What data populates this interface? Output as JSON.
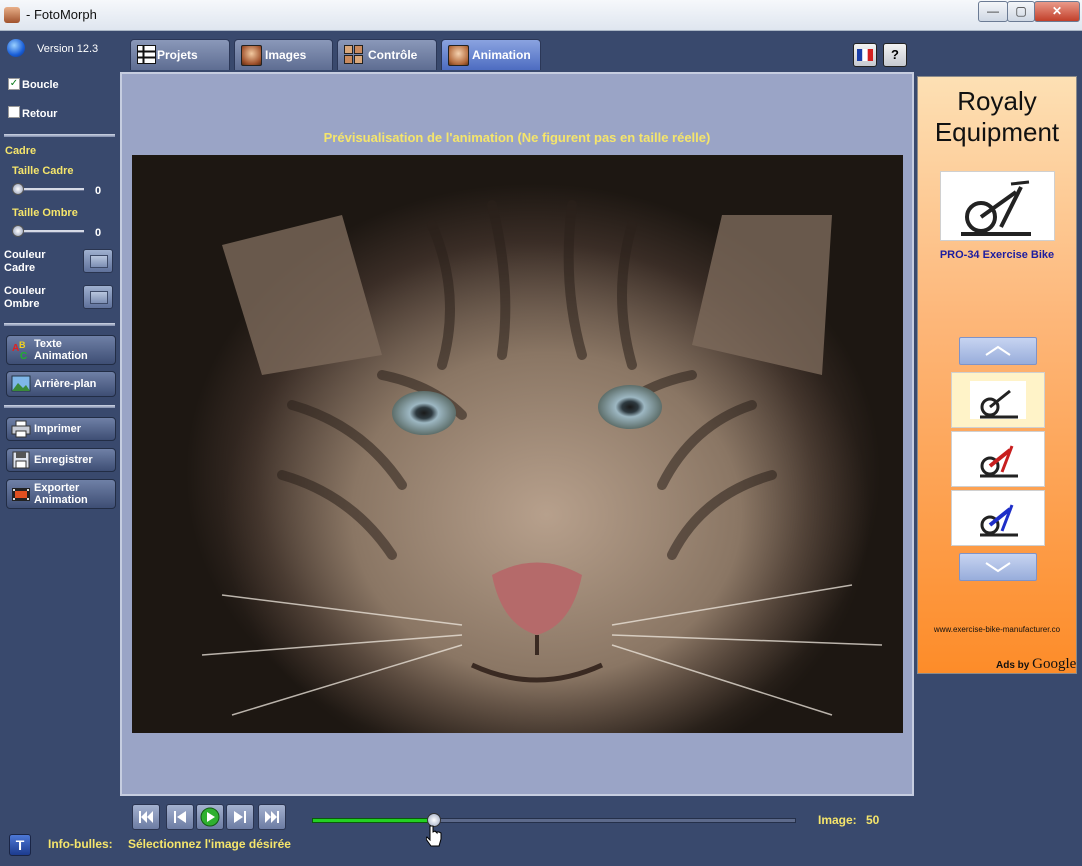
{
  "window": {
    "title": "- FotoMorph",
    "minimize_label": "—",
    "maximize_label": "▢",
    "close_label": "✕"
  },
  "sidebar": {
    "version": "Version 12.3",
    "loop_label": "Boucle",
    "loop_checked": true,
    "return_label": "Retour",
    "return_checked": false,
    "frame_section": "Cadre",
    "frame_size_label": "Taille Cadre",
    "frame_size_value": "0",
    "shadow_size_label": "Taille Ombre",
    "shadow_size_value": "0",
    "frame_color_label_1": "Couleur",
    "frame_color_label_2": "Cadre",
    "shadow_color_label_1": "Couleur",
    "shadow_color_label_2": "Ombre",
    "text_anim_label_1": "Texte",
    "text_anim_label_2": "Animation",
    "background_label": "Arrière-plan",
    "print_label": "Imprimer",
    "save_label": "Enregistrer",
    "export_label_1": "Exporter",
    "export_label_2": "Animation"
  },
  "tabs": [
    {
      "label": "Projets",
      "icon": "film-grid-icon"
    },
    {
      "label": "Images",
      "icon": "portrait-icon"
    },
    {
      "label": "Contrôle",
      "icon": "control-grid-icon"
    },
    {
      "label": "Animation",
      "icon": "animation-portrait-icon",
      "active": true
    }
  ],
  "toolbar": {
    "help_label": "?"
  },
  "preview": {
    "title": "Prévisualisation de l'animation (Ne figurent pas en taille réelle)"
  },
  "ad": {
    "title_line1": "Royaly",
    "title_line2": "Equipment",
    "product": "PRO-34 Exercise Bike",
    "url": "www.exercise-bike-manufacturer.co",
    "ads_by": "Ads by",
    "google": "Google"
  },
  "playback": {
    "image_label": "Image:",
    "image_value": "50",
    "slider_fraction": 0.25
  },
  "status": {
    "tooltip_label": "Info-bulles:",
    "tooltip_text": "Sélectionnez l'image désirée",
    "t_button": "T"
  },
  "colors": {
    "accent_yellow": "#f5e56b",
    "panel_blue": "#39496d",
    "ad_orange": "#fd8c29"
  }
}
